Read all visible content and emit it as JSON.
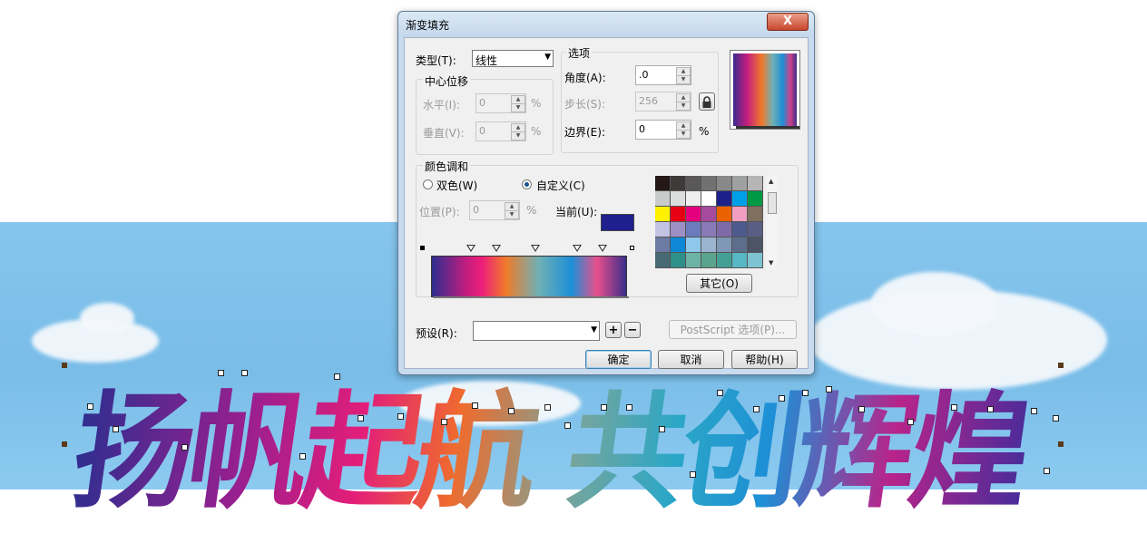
{
  "dialog": {
    "title": "渐变填充",
    "close_glyph": "X",
    "type_label": "类型(T):",
    "type_value": "线性",
    "center_offset_title": "中心位移",
    "horizontal_label": "水平(I):",
    "horizontal_value": "0",
    "vertical_label": "垂直(V):",
    "vertical_value": "0",
    "percent": "%",
    "options_title": "选项",
    "angle_label": "角度(A):",
    "angle_value": ".0",
    "steps_label": "步长(S):",
    "steps_value": "256",
    "edge_label": "边界(E):",
    "edge_value": "0",
    "blend_title": "颜色调和",
    "two_color_label": "双色(W)",
    "custom_label": "自定义(C)",
    "position_label": "位置(P):",
    "position_value": "0",
    "current_label": "当前(U):",
    "current_color": "#1f1f8f",
    "other_button": "其它(O)",
    "preset_label": "预设(R):",
    "preset_value": "",
    "postscript_button": "PostScript 选项(P)...",
    "ok_button": "确定",
    "cancel_button": "取消",
    "help_button": "帮助(H)",
    "palette": [
      [
        "#231815",
        "#3e3a39",
        "#595757",
        "#727171",
        "#898989",
        "#9fa0a0",
        "#b5b5b6"
      ],
      [
        "#c9caca",
        "#dcdddd",
        "#efefef",
        "#ffffff",
        "#1d2088",
        "#00a0e9",
        "#009944"
      ],
      [
        "#fff100",
        "#e60012",
        "#e4007f",
        "#a64a9e",
        "#eb6100",
        "#f19ec2",
        "#7f6f5e"
      ],
      [
        "#c3c3e6",
        "#9e8fc4",
        "#6c7bbd",
        "#8a7ab8",
        "#7f6aa8",
        "#4d5a8e",
        "#595f84"
      ],
      [
        "#6c7ba4",
        "#0e88d6",
        "#8fc8ea",
        "#9bb4d0",
        "#7f97b6",
        "#5d6e8c",
        "#4c5466"
      ],
      [
        "#476a74",
        "#2f8f89",
        "#6db3a5",
        "#5aa38c",
        "#44a095",
        "#58b7c4",
        "#7dc3d2"
      ]
    ]
  },
  "artwork": {
    "text": "扬帆起航 共创辉煌"
  }
}
